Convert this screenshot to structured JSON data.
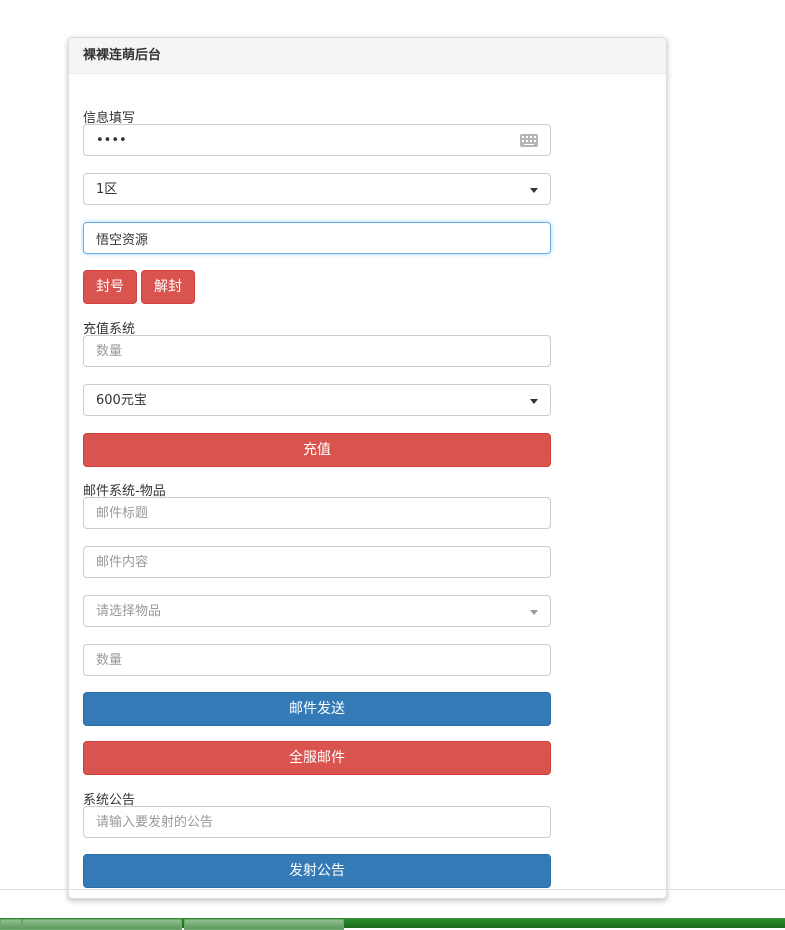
{
  "panel": {
    "title": "裸裸连萌后台"
  },
  "info": {
    "label": "信息填写",
    "account_value": "••••",
    "server_selected": "1区",
    "player_value": "悟空资源",
    "ban_label": "封号",
    "unban_label": "解封"
  },
  "recharge": {
    "label": "充值系统",
    "amount_placeholder": "数量",
    "package_selected": "600元宝",
    "submit_label": "充值"
  },
  "mail": {
    "label": "邮件系统-物品",
    "title_placeholder": "邮件标题",
    "content_placeholder": "邮件内容",
    "item_placeholder": "请选择物品",
    "quantity_placeholder": "数量",
    "send_label": "邮件发送",
    "all_server_label": "全服邮件"
  },
  "announcement": {
    "label": "系统公告",
    "input_placeholder": "请输入要发射的公告",
    "submit_label": "发射公告"
  },
  "icons": {
    "keyboard": "keyboard-icon",
    "dropdown": "chevron-down-icon"
  },
  "colors": {
    "danger": "#d9534f",
    "primary": "#337ab7",
    "focus": "#66afe9"
  }
}
